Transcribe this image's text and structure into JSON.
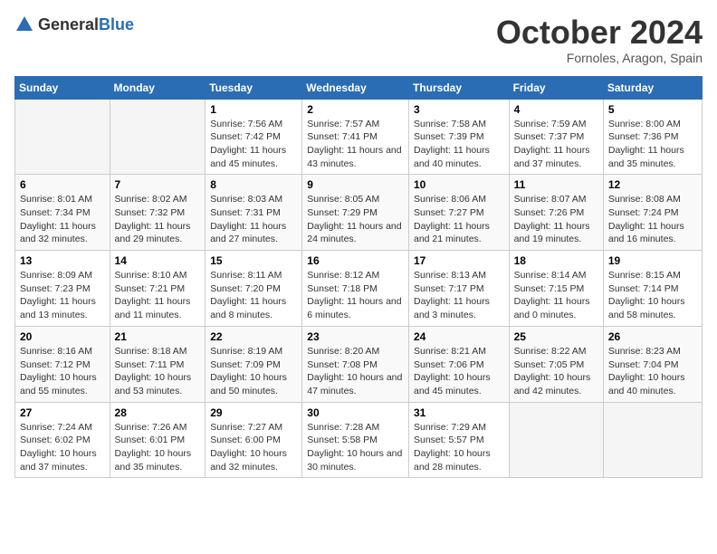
{
  "logo": {
    "general": "General",
    "blue": "Blue"
  },
  "header": {
    "month": "October 2024",
    "location": "Fornoles, Aragon, Spain"
  },
  "weekdays": [
    "Sunday",
    "Monday",
    "Tuesday",
    "Wednesday",
    "Thursday",
    "Friday",
    "Saturday"
  ],
  "weeks": [
    [
      {
        "day": null
      },
      {
        "day": null
      },
      {
        "day": "1",
        "sunrise": "Sunrise: 7:56 AM",
        "sunset": "Sunset: 7:42 PM",
        "daylight": "Daylight: 11 hours and 45 minutes."
      },
      {
        "day": "2",
        "sunrise": "Sunrise: 7:57 AM",
        "sunset": "Sunset: 7:41 PM",
        "daylight": "Daylight: 11 hours and 43 minutes."
      },
      {
        "day": "3",
        "sunrise": "Sunrise: 7:58 AM",
        "sunset": "Sunset: 7:39 PM",
        "daylight": "Daylight: 11 hours and 40 minutes."
      },
      {
        "day": "4",
        "sunrise": "Sunrise: 7:59 AM",
        "sunset": "Sunset: 7:37 PM",
        "daylight": "Daylight: 11 hours and 37 minutes."
      },
      {
        "day": "5",
        "sunrise": "Sunrise: 8:00 AM",
        "sunset": "Sunset: 7:36 PM",
        "daylight": "Daylight: 11 hours and 35 minutes."
      }
    ],
    [
      {
        "day": "6",
        "sunrise": "Sunrise: 8:01 AM",
        "sunset": "Sunset: 7:34 PM",
        "daylight": "Daylight: 11 hours and 32 minutes."
      },
      {
        "day": "7",
        "sunrise": "Sunrise: 8:02 AM",
        "sunset": "Sunset: 7:32 PM",
        "daylight": "Daylight: 11 hours and 29 minutes."
      },
      {
        "day": "8",
        "sunrise": "Sunrise: 8:03 AM",
        "sunset": "Sunset: 7:31 PM",
        "daylight": "Daylight: 11 hours and 27 minutes."
      },
      {
        "day": "9",
        "sunrise": "Sunrise: 8:05 AM",
        "sunset": "Sunset: 7:29 PM",
        "daylight": "Daylight: 11 hours and 24 minutes."
      },
      {
        "day": "10",
        "sunrise": "Sunrise: 8:06 AM",
        "sunset": "Sunset: 7:27 PM",
        "daylight": "Daylight: 11 hours and 21 minutes."
      },
      {
        "day": "11",
        "sunrise": "Sunrise: 8:07 AM",
        "sunset": "Sunset: 7:26 PM",
        "daylight": "Daylight: 11 hours and 19 minutes."
      },
      {
        "day": "12",
        "sunrise": "Sunrise: 8:08 AM",
        "sunset": "Sunset: 7:24 PM",
        "daylight": "Daylight: 11 hours and 16 minutes."
      }
    ],
    [
      {
        "day": "13",
        "sunrise": "Sunrise: 8:09 AM",
        "sunset": "Sunset: 7:23 PM",
        "daylight": "Daylight: 11 hours and 13 minutes."
      },
      {
        "day": "14",
        "sunrise": "Sunrise: 8:10 AM",
        "sunset": "Sunset: 7:21 PM",
        "daylight": "Daylight: 11 hours and 11 minutes."
      },
      {
        "day": "15",
        "sunrise": "Sunrise: 8:11 AM",
        "sunset": "Sunset: 7:20 PM",
        "daylight": "Daylight: 11 hours and 8 minutes."
      },
      {
        "day": "16",
        "sunrise": "Sunrise: 8:12 AM",
        "sunset": "Sunset: 7:18 PM",
        "daylight": "Daylight: 11 hours and 6 minutes."
      },
      {
        "day": "17",
        "sunrise": "Sunrise: 8:13 AM",
        "sunset": "Sunset: 7:17 PM",
        "daylight": "Daylight: 11 hours and 3 minutes."
      },
      {
        "day": "18",
        "sunrise": "Sunrise: 8:14 AM",
        "sunset": "Sunset: 7:15 PM",
        "daylight": "Daylight: 11 hours and 0 minutes."
      },
      {
        "day": "19",
        "sunrise": "Sunrise: 8:15 AM",
        "sunset": "Sunset: 7:14 PM",
        "daylight": "Daylight: 10 hours and 58 minutes."
      }
    ],
    [
      {
        "day": "20",
        "sunrise": "Sunrise: 8:16 AM",
        "sunset": "Sunset: 7:12 PM",
        "daylight": "Daylight: 10 hours and 55 minutes."
      },
      {
        "day": "21",
        "sunrise": "Sunrise: 8:18 AM",
        "sunset": "Sunset: 7:11 PM",
        "daylight": "Daylight: 10 hours and 53 minutes."
      },
      {
        "day": "22",
        "sunrise": "Sunrise: 8:19 AM",
        "sunset": "Sunset: 7:09 PM",
        "daylight": "Daylight: 10 hours and 50 minutes."
      },
      {
        "day": "23",
        "sunrise": "Sunrise: 8:20 AM",
        "sunset": "Sunset: 7:08 PM",
        "daylight": "Daylight: 10 hours and 47 minutes."
      },
      {
        "day": "24",
        "sunrise": "Sunrise: 8:21 AM",
        "sunset": "Sunset: 7:06 PM",
        "daylight": "Daylight: 10 hours and 45 minutes."
      },
      {
        "day": "25",
        "sunrise": "Sunrise: 8:22 AM",
        "sunset": "Sunset: 7:05 PM",
        "daylight": "Daylight: 10 hours and 42 minutes."
      },
      {
        "day": "26",
        "sunrise": "Sunrise: 8:23 AM",
        "sunset": "Sunset: 7:04 PM",
        "daylight": "Daylight: 10 hours and 40 minutes."
      }
    ],
    [
      {
        "day": "27",
        "sunrise": "Sunrise: 7:24 AM",
        "sunset": "Sunset: 6:02 PM",
        "daylight": "Daylight: 10 hours and 37 minutes."
      },
      {
        "day": "28",
        "sunrise": "Sunrise: 7:26 AM",
        "sunset": "Sunset: 6:01 PM",
        "daylight": "Daylight: 10 hours and 35 minutes."
      },
      {
        "day": "29",
        "sunrise": "Sunrise: 7:27 AM",
        "sunset": "Sunset: 6:00 PM",
        "daylight": "Daylight: 10 hours and 32 minutes."
      },
      {
        "day": "30",
        "sunrise": "Sunrise: 7:28 AM",
        "sunset": "Sunset: 5:58 PM",
        "daylight": "Daylight: 10 hours and 30 minutes."
      },
      {
        "day": "31",
        "sunrise": "Sunrise: 7:29 AM",
        "sunset": "Sunset: 5:57 PM",
        "daylight": "Daylight: 10 hours and 28 minutes."
      },
      {
        "day": null
      },
      {
        "day": null
      }
    ]
  ]
}
